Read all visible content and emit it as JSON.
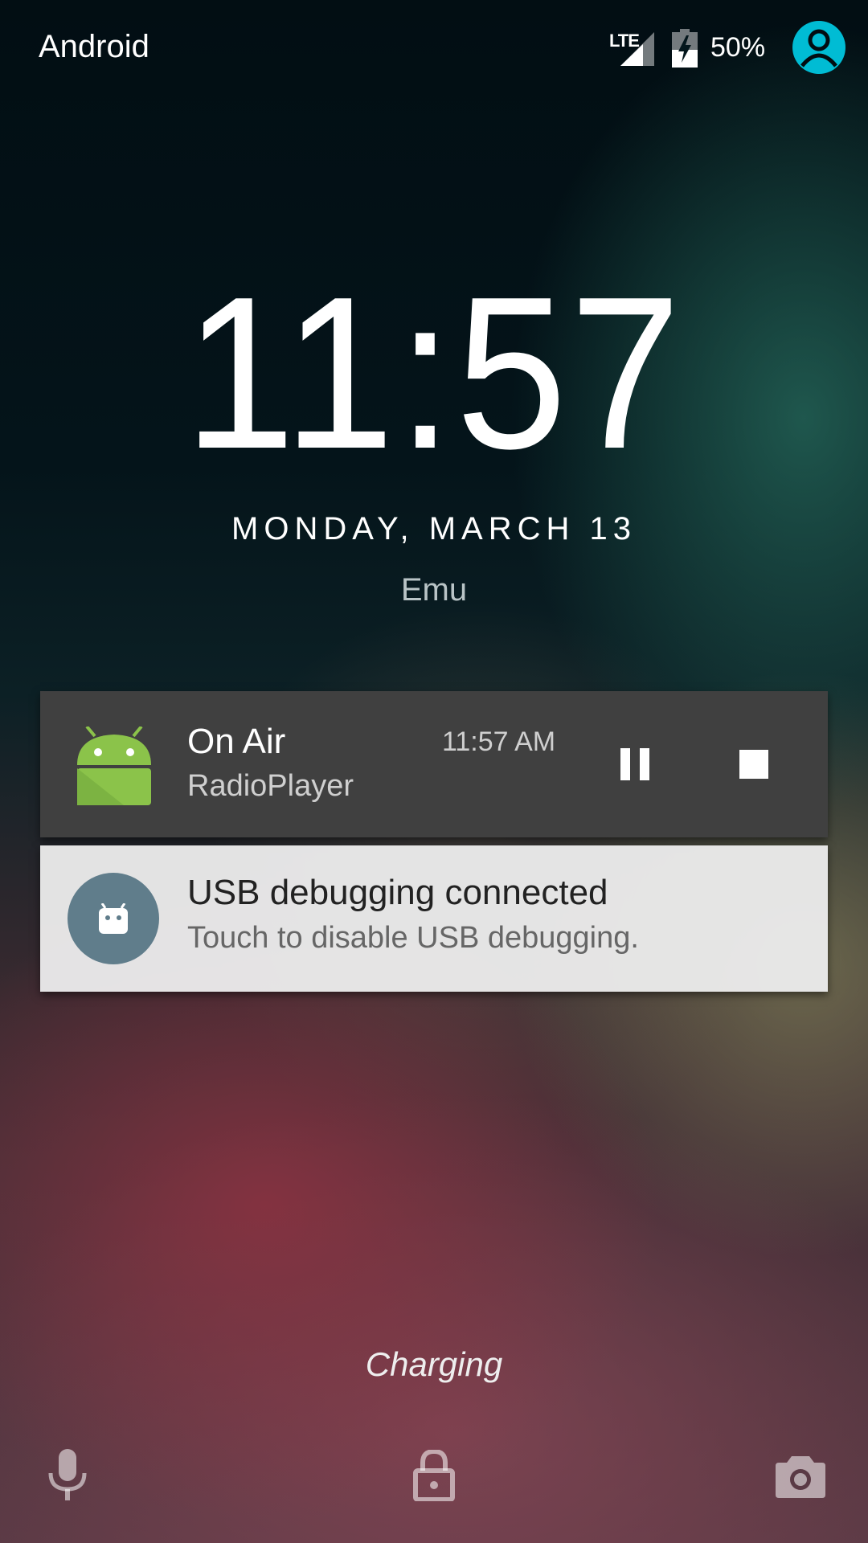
{
  "status_bar": {
    "carrier": "Android",
    "network_type": "LTE",
    "battery_percent": "50%",
    "icons": [
      "signal-icon",
      "battery-charging-icon",
      "user-avatar-icon"
    ]
  },
  "lockscreen": {
    "time": "11:57",
    "date": "MONDAY, MARCH 13",
    "owner_info": "Emu",
    "charging_text": "Charging"
  },
  "notifications": [
    {
      "icon": "android-app-icon",
      "title": "On Air",
      "text": "RadioPlayer",
      "time": "11:57 AM",
      "actions": [
        "pause-icon",
        "stop-icon"
      ]
    },
    {
      "icon": "usb-debug-icon",
      "title": "USB debugging connected",
      "text": "Touch to disable USB debugging."
    }
  ],
  "bottom_actions": [
    "microphone-icon",
    "lock-icon",
    "camera-icon"
  ],
  "colors": {
    "avatar": "#00bcd4",
    "android_green": "#8bc34a",
    "usb_icon_bg": "#607d8b",
    "media_notification_bg": "#404040",
    "usb_notification_bg": "#ebebeb"
  }
}
